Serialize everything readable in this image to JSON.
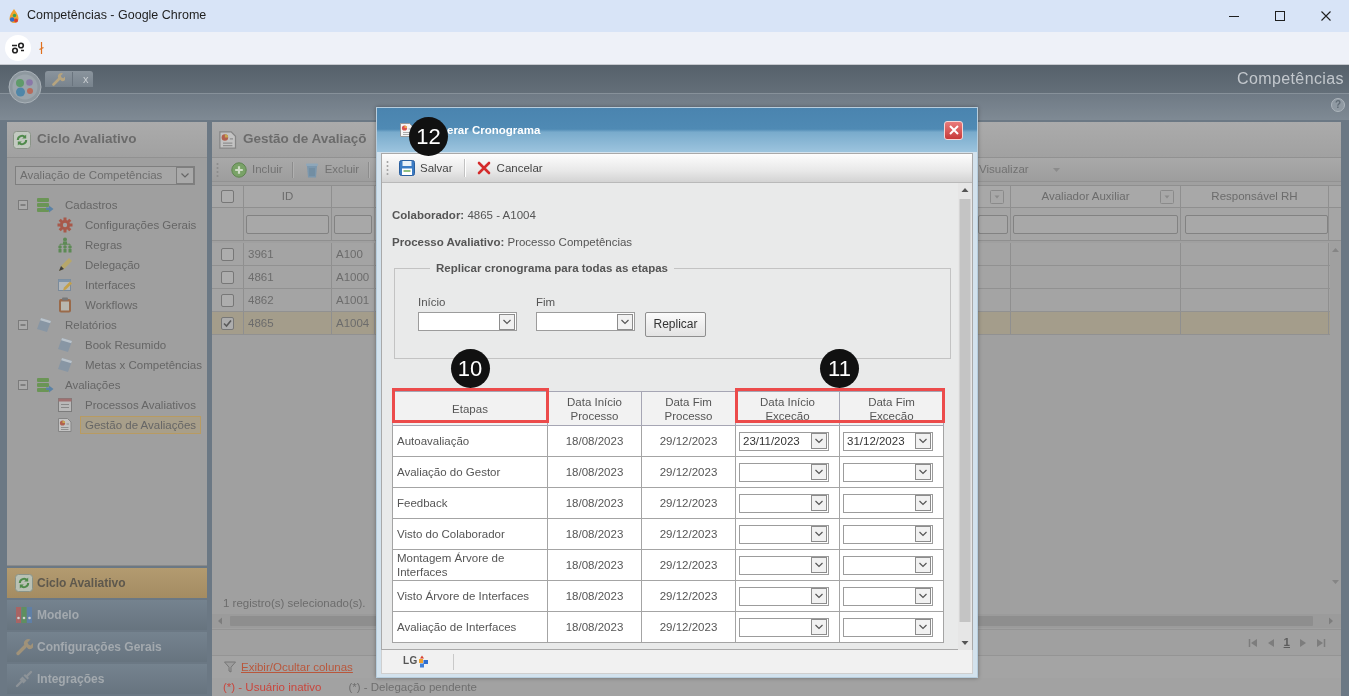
{
  "browser_window": {
    "title": "Competências - Google Chrome"
  },
  "app_header": {
    "title": "Competências",
    "tab_close": "x",
    "help": "?"
  },
  "sidebar": {
    "title": "Ciclo Avaliativo",
    "process_select": {
      "value": "Avaliação de Competências"
    },
    "tree": [
      {
        "label": "Cadastros",
        "expanded": true,
        "selected": false,
        "children": [
          {
            "label": "Configurações Gerais",
            "selected": false
          },
          {
            "label": "Regras",
            "selected": false
          },
          {
            "label": "Delegação",
            "selected": false
          },
          {
            "label": "Interfaces",
            "selected": false
          },
          {
            "label": "Workflows",
            "selected": false
          }
        ]
      },
      {
        "label": "Relatórios",
        "expanded": true,
        "selected": false,
        "children": [
          {
            "label": "Book Resumido",
            "selected": false
          },
          {
            "label": "Metas x Competências",
            "selected": false
          }
        ]
      },
      {
        "label": "Avaliações",
        "expanded": true,
        "selected": false,
        "children": [
          {
            "label": "Processos Avaliativos",
            "selected": false
          },
          {
            "label": "Gestão de Avaliações",
            "selected": true
          }
        ]
      }
    ],
    "modules": [
      {
        "label": "Ciclo Avaliativo",
        "selected": true
      },
      {
        "label": "Modelo",
        "selected": false
      },
      {
        "label": "Configurações Gerais",
        "selected": false
      },
      {
        "label": "Integrações",
        "selected": false
      }
    ]
  },
  "main": {
    "title": "Gestão de Avaliaçõ",
    "toolbar": [
      {
        "label": "Incluir"
      },
      {
        "label": "Excluir"
      }
    ],
    "view_button": {
      "label": "Visualizar"
    },
    "grid": {
      "select_all": {
        "checked": false
      },
      "id_column": {
        "label": "ID"
      },
      "right_columns": [
        {
          "menu": true
        },
        {
          "label": "Avaliador Auxiliar",
          "menu": true
        },
        {
          "label": "Responsável RH",
          "menu": false
        }
      ],
      "rows": [
        {
          "id": "3961",
          "column_3": "A100",
          "selected": false
        },
        {
          "id": "4861",
          "column_3": "A1000",
          "selected": false
        },
        {
          "id": "4862",
          "column_3": "A1001",
          "selected": false
        },
        {
          "id": "4865",
          "column_3": "A1004",
          "selected": true
        }
      ]
    },
    "selection_summary": "1 registro(s) selecionado(s).",
    "pager": {
      "page": "1"
    },
    "columns_link": "Exibir/Ocultar colunas",
    "legend": [
      {
        "text": "(*) - Usuário inativo",
        "color": "#c9463d"
      },
      {
        "text": "(*) - Delegação pendente",
        "color": "#6f6f6f"
      }
    ]
  },
  "dialog": {
    "title": "erar Cronograma",
    "callout": "12",
    "toolbar": [
      {
        "label": "Salvar"
      },
      {
        "label": "Cancelar"
      }
    ],
    "details": [
      "**Colaborador:** 4865 - A1004",
      "**Processo Avaliativo:** Processo Competências"
    ],
    "replicate": {
      "legend": "Replicar cronograma para todas as etapas",
      "fields": [
        {
          "label": "Início"
        },
        {
          "label": "Fim"
        }
      ],
      "button": "Replicar"
    },
    "schedule": {
      "columns": [
        {
          "label": "Etapas",
          "highlighted": true,
          "callout": "10"
        },
        {
          "label": "Data Início Processo",
          "highlighted": false
        },
        {
          "label": "Data Fim Processo",
          "highlighted": false
        },
        {
          "label": "Data Início Exceção",
          "highlighted": true,
          "callout": "11"
        },
        {
          "label": "Data Fim Exceção",
          "highlighted": true
        }
      ],
      "rows": [
        {
          "stage": "Autoavaliação",
          "process_start": "18/08/2023",
          "process_end": "29/12/2023",
          "exception_start": "23/11/2023",
          "exception_end": "31/12/2023"
        },
        {
          "stage": "Avaliação do Gestor",
          "process_start": "18/08/2023",
          "process_end": "29/12/2023"
        },
        {
          "stage": "Feedback",
          "process_start": "18/08/2023",
          "process_end": "29/12/2023"
        },
        {
          "stage": "Visto do Colaborador",
          "process_start": "18/08/2023",
          "process_end": "29/12/2023"
        },
        {
          "stage": "Montagem Árvore de Interfaces",
          "process_start": "18/08/2023",
          "process_end": "29/12/2023"
        },
        {
          "stage": "Visto Árvore de Interfaces",
          "process_start": "18/08/2023",
          "process_end": "29/12/2023"
        },
        {
          "stage": "Avaliação de Interfaces",
          "process_start": "18/08/2023",
          "process_end": "29/12/2023"
        }
      ]
    },
    "footer_logo": "LG"
  }
}
